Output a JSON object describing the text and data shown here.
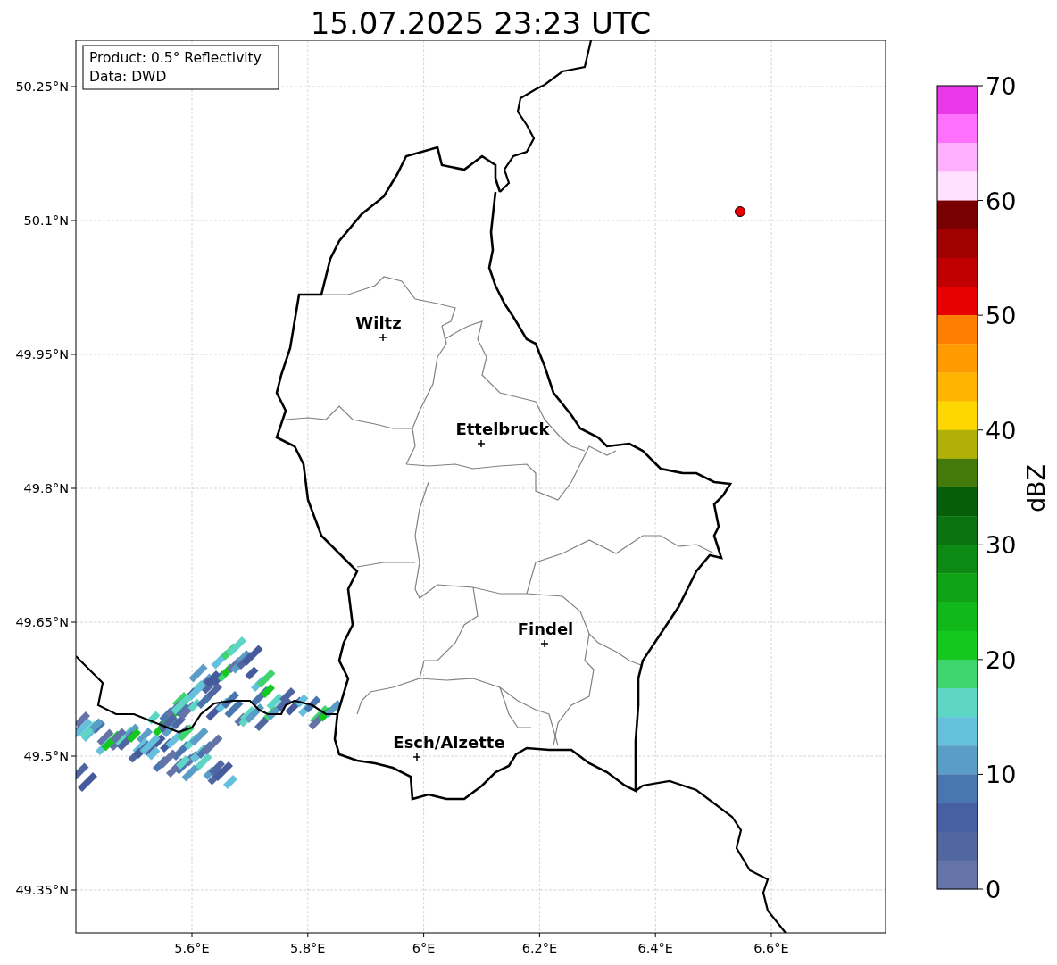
{
  "title": "15.07.2025 23:23 UTC",
  "info_box": {
    "lines": [
      "Product: 0.5° Reflectivity",
      "Data: DWD"
    ]
  },
  "map": {
    "y_ticks": [
      "50.25°N",
      "50.1°N",
      "49.95°N",
      "49.8°N",
      "49.65°N",
      "49.5°N",
      "49.35°N"
    ],
    "x_ticks": [
      "5.6°E",
      "5.8°E",
      "6°E",
      "6.2°E",
      "6.4°E",
      "6.6°E"
    ],
    "cities": [
      {
        "name": "Wiltz"
      },
      {
        "name": "Ettelbruck"
      },
      {
        "name": "Findel"
      },
      {
        "name": "Esch/Alzette"
      }
    ]
  },
  "colorbar": {
    "label": "dBZ",
    "ticks": [
      "70",
      "60",
      "50",
      "40",
      "30",
      "20",
      "10",
      "0"
    ],
    "segments": [
      {
        "color": "#e838e8"
      },
      {
        "color": "#ff70ff"
      },
      {
        "color": "#ffb0ff"
      },
      {
        "color": "#ffe0ff"
      },
      {
        "color": "#780000"
      },
      {
        "color": "#a00000"
      },
      {
        "color": "#c00000"
      },
      {
        "color": "#e60000"
      },
      {
        "color": "#ff7f00"
      },
      {
        "color": "#ff9a00"
      },
      {
        "color": "#ffb400"
      },
      {
        "color": "#ffd700"
      },
      {
        "color": "#b0b008"
      },
      {
        "color": "#447a0a"
      },
      {
        "color": "#075e0a"
      },
      {
        "color": "#0b7410"
      },
      {
        "color": "#0d8a14"
      },
      {
        "color": "#0ea314"
      },
      {
        "color": "#10b81a"
      },
      {
        "color": "#14c81e"
      },
      {
        "color": "#3ed46e"
      },
      {
        "color": "#5dd6c6"
      },
      {
        "color": "#64c0dc"
      },
      {
        "color": "#5a9ec8"
      },
      {
        "color": "#4a76b0"
      },
      {
        "color": "#4760a3"
      },
      {
        "color": "#52679f"
      },
      {
        "color": "#6474a8"
      }
    ]
  }
}
